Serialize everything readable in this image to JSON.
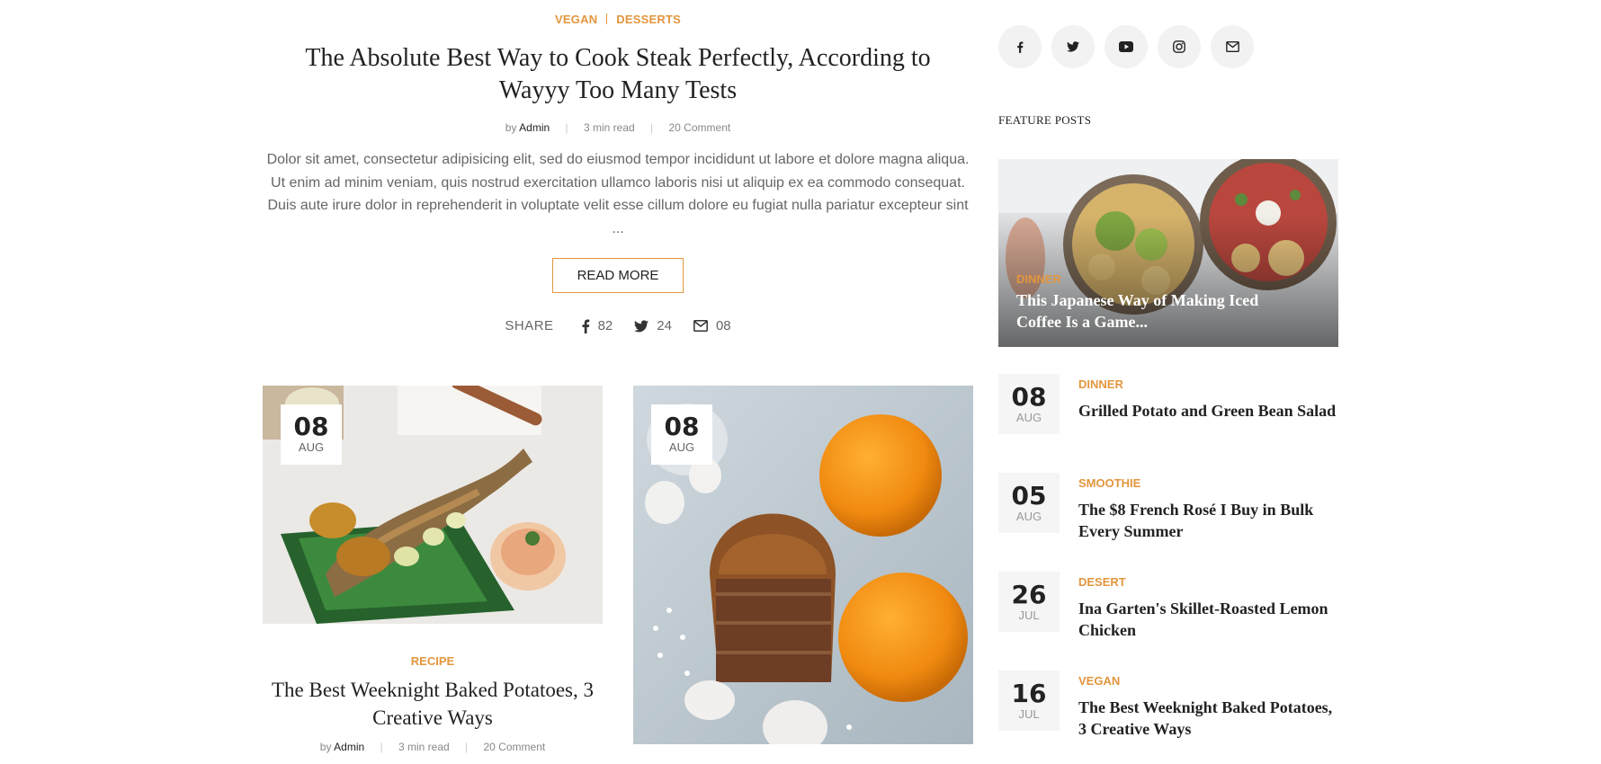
{
  "hero": {
    "categories": [
      "VEGAN",
      "DESSERTS"
    ],
    "title": "The Absolute Best Way to Cook Steak Perfectly, According to Wayyy Too Many Tests",
    "meta": {
      "by": "by",
      "author": "Admin",
      "read_time": "3 min read",
      "comments": "20 Comment"
    },
    "excerpt": "Dolor sit amet, consectetur adipisicing elit, sed do eiusmod tempor incididunt ut labore et dolore magna aliqua. Ut enim ad minim veniam, quis nostrud exercitation ullamco laboris nisi ut aliquip ex ea commodo consequat. Duis aute irure dolor in reprehenderit in voluptate velit esse cillum dolore eu fugiat nulla pariatur excepteur sint ...",
    "read_more": "READ MORE",
    "share": {
      "label": "SHARE",
      "facebook": "82",
      "twitter": "24",
      "email": "08"
    }
  },
  "cards": [
    {
      "day": "08",
      "month": "AUG",
      "category": "RECIPE",
      "title": "The Best Weeknight Baked Potatoes, 3 Creative Ways",
      "meta": {
        "by": "by",
        "author": "Admin",
        "read_time": "3 min read",
        "comments": "20 Comment"
      }
    },
    {
      "day": "08",
      "month": "AUG"
    }
  ],
  "sidebar": {
    "socials": [
      "facebook-icon",
      "twitter-icon",
      "youtube-icon",
      "instagram-icon",
      "mail-icon"
    ],
    "feature_heading": "FEATURE POSTS",
    "feature": {
      "category": "DINNER",
      "title": "This Japanese Way of Making Iced Coffee Is a Game..."
    },
    "posts": [
      {
        "day": "08",
        "month": "AUG",
        "category": "DINNER",
        "title": "Grilled Potato and Green Bean Salad"
      },
      {
        "day": "05",
        "month": "AUG",
        "category": "SMOOTHIE",
        "title": "The $8 French Rosé I Buy in Bulk Every Summer"
      },
      {
        "day": "26",
        "month": "JUL",
        "category": "DESERT",
        "title": "Ina Garten's Skillet-Roasted Lemon Chicken"
      },
      {
        "day": "16",
        "month": "JUL",
        "category": "VEGAN",
        "title": "The Best Weeknight Baked Potatoes, 3 Creative Ways"
      }
    ]
  },
  "colors": {
    "accent": "#e3963e",
    "text": "#222222",
    "muted": "#666666"
  }
}
